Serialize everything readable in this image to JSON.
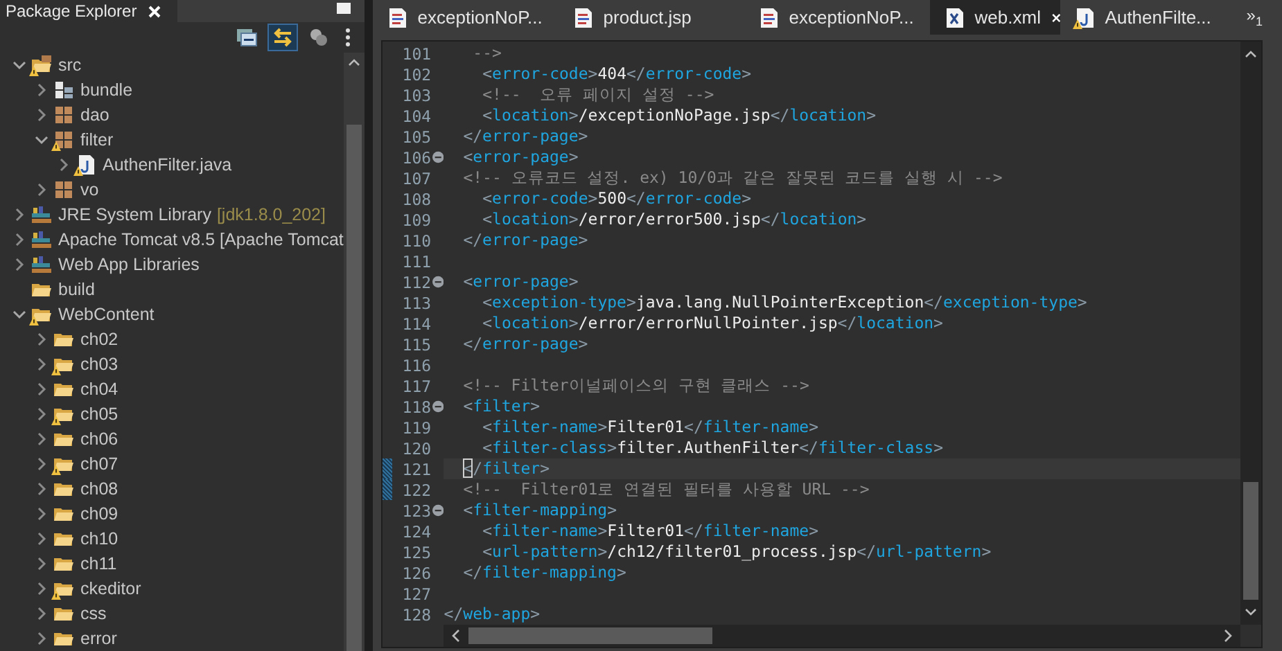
{
  "explorer": {
    "title": "Package Explorer",
    "toolbar": [
      {
        "kind": "collapse",
        "selected": false
      },
      {
        "kind": "link",
        "selected": true
      },
      {
        "kind": "filter",
        "selected": false
      },
      {
        "kind": "menu",
        "selected": false
      }
    ],
    "tree": [
      {
        "label": "src",
        "kind": "source-folder",
        "expanded": true,
        "warning": true,
        "children": [
          {
            "label": "bundle",
            "kind": "bundle",
            "expanded": false,
            "warning": false
          },
          {
            "label": "dao",
            "kind": "package",
            "expanded": false,
            "warning": false
          },
          {
            "label": "filter",
            "kind": "package",
            "expanded": true,
            "warning": true,
            "children": [
              {
                "label": "AuthenFilter.java",
                "kind": "java-file",
                "expanded": false,
                "warning": true
              }
            ]
          },
          {
            "label": "vo",
            "kind": "package",
            "expanded": false,
            "warning": false
          }
        ]
      },
      {
        "label": "JRE System Library",
        "decoration": "[jdk1.8.0_202]",
        "kind": "library",
        "expanded": false,
        "warning": false
      },
      {
        "label": "Apache Tomcat v8.5 [Apache Tomcat",
        "kind": "library",
        "expanded": false,
        "warning": false
      },
      {
        "label": "Web App Libraries",
        "kind": "library",
        "expanded": false,
        "warning": false
      },
      {
        "label": "build",
        "kind": "folder",
        "warning": false
      },
      {
        "label": "WebContent",
        "kind": "folder",
        "expanded": true,
        "warning": true,
        "children": [
          {
            "label": "ch02",
            "kind": "folder",
            "expanded": false,
            "warning": false
          },
          {
            "label": "ch03",
            "kind": "folder",
            "expanded": false,
            "warning": true
          },
          {
            "label": "ch04",
            "kind": "folder",
            "expanded": false,
            "warning": false
          },
          {
            "label": "ch05",
            "kind": "folder",
            "expanded": false,
            "warning": true
          },
          {
            "label": "ch06",
            "kind": "folder",
            "expanded": false,
            "warning": false
          },
          {
            "label": "ch07",
            "kind": "folder",
            "expanded": false,
            "warning": true
          },
          {
            "label": "ch08",
            "kind": "folder",
            "expanded": false,
            "warning": false
          },
          {
            "label": "ch09",
            "kind": "folder",
            "expanded": false,
            "warning": false
          },
          {
            "label": "ch10",
            "kind": "folder",
            "expanded": false,
            "warning": false
          },
          {
            "label": "ch11",
            "kind": "folder",
            "expanded": false,
            "warning": false
          },
          {
            "label": "ckeditor",
            "kind": "folder",
            "expanded": false,
            "warning": true
          },
          {
            "label": "css",
            "kind": "folder",
            "expanded": false,
            "warning": false
          },
          {
            "label": "error",
            "kind": "folder",
            "expanded": false,
            "warning": false
          }
        ]
      }
    ]
  },
  "tabs": [
    {
      "label": "exceptionNoP...",
      "kind": "jsp",
      "selected": false,
      "warning": false
    },
    {
      "label": "product.jsp",
      "kind": "jsp",
      "selected": false,
      "warning": false
    },
    {
      "label": "exceptionNoP...",
      "kind": "jsp",
      "selected": false,
      "warning": false
    },
    {
      "label": "web.xml",
      "kind": "xml",
      "selected": true,
      "warning": false
    },
    {
      "label": "AuthenFilte...",
      "kind": "java",
      "selected": false,
      "warning": true
    }
  ],
  "overflow": {
    "symbol": "»",
    "count": "1"
  },
  "lines": [
    {
      "n": "101",
      "kind": "continuation",
      "fold": false,
      "current": false,
      "changed": false,
      "tokens": [
        {
          "kind": "comment",
          "text": "-->"
        }
      ]
    },
    {
      "n": "102",
      "kind": "inner",
      "fold": false,
      "current": false,
      "changed": false,
      "tokens": [
        {
          "kind": "punct",
          "text": "<"
        },
        {
          "kind": "tag",
          "text": "error-code"
        },
        {
          "kind": "punct",
          "text": ">"
        },
        {
          "kind": "text",
          "text": "404"
        },
        {
          "kind": "punct",
          "text": "</"
        },
        {
          "kind": "tag",
          "text": "error-code"
        },
        {
          "kind": "punct",
          "text": ">"
        }
      ]
    },
    {
      "n": "103",
      "kind": "inner",
      "fold": false,
      "current": false,
      "changed": false,
      "tokens": [
        {
          "kind": "comment",
          "text": "<!--  오류 페이지 설정 -->"
        }
      ]
    },
    {
      "n": "104",
      "kind": "inner",
      "fold": false,
      "current": false,
      "changed": false,
      "tokens": [
        {
          "kind": "punct",
          "text": "<"
        },
        {
          "kind": "tag",
          "text": "location"
        },
        {
          "kind": "punct",
          "text": ">"
        },
        {
          "kind": "text",
          "text": "/exceptionNoPage.jsp"
        },
        {
          "kind": "punct",
          "text": "</"
        },
        {
          "kind": "tag",
          "text": "location"
        },
        {
          "kind": "punct",
          "text": ">"
        }
      ]
    },
    {
      "n": "105",
      "kind": "outer",
      "fold": false,
      "current": false,
      "changed": false,
      "tokens": [
        {
          "kind": "punct",
          "text": "</"
        },
        {
          "kind": "tag",
          "text": "error-page"
        },
        {
          "kind": "punct",
          "text": ">"
        }
      ]
    },
    {
      "n": "106",
      "kind": "outer",
      "fold": true,
      "current": false,
      "changed": false,
      "tokens": [
        {
          "kind": "punct",
          "text": "<"
        },
        {
          "kind": "tag",
          "text": "error-page"
        },
        {
          "kind": "punct",
          "text": ">"
        }
      ]
    },
    {
      "n": "107",
      "kind": "outer",
      "fold": false,
      "current": false,
      "changed": false,
      "tokens": [
        {
          "kind": "comment",
          "text": "<!-- 오류코드 설정. ex) 10/0과 같은 잘못된 코드를 실행 시 -->"
        }
      ]
    },
    {
      "n": "108",
      "kind": "inner",
      "fold": false,
      "current": false,
      "changed": false,
      "tokens": [
        {
          "kind": "punct",
          "text": "<"
        },
        {
          "kind": "tag",
          "text": "error-code"
        },
        {
          "kind": "punct",
          "text": ">"
        },
        {
          "kind": "text",
          "text": "500"
        },
        {
          "kind": "punct",
          "text": "</"
        },
        {
          "kind": "tag",
          "text": "error-code"
        },
        {
          "kind": "punct",
          "text": ">"
        }
      ]
    },
    {
      "n": "109",
      "kind": "inner",
      "fold": false,
      "current": false,
      "changed": false,
      "tokens": [
        {
          "kind": "punct",
          "text": "<"
        },
        {
          "kind": "tag",
          "text": "location"
        },
        {
          "kind": "punct",
          "text": ">"
        },
        {
          "kind": "text",
          "text": "/error/error500.jsp"
        },
        {
          "kind": "punct",
          "text": "</"
        },
        {
          "kind": "tag",
          "text": "location"
        },
        {
          "kind": "punct",
          "text": ">"
        }
      ]
    },
    {
      "n": "110",
      "kind": "outer",
      "fold": false,
      "current": false,
      "changed": false,
      "tokens": [
        {
          "kind": "punct",
          "text": "</"
        },
        {
          "kind": "tag",
          "text": "error-page"
        },
        {
          "kind": "punct",
          "text": ">"
        }
      ]
    },
    {
      "n": "111",
      "kind": "blank",
      "fold": false,
      "changed": false
    },
    {
      "n": "112",
      "kind": "outer",
      "fold": true,
      "current": false,
      "changed": false,
      "tokens": [
        {
          "kind": "punct",
          "text": "<"
        },
        {
          "kind": "tag",
          "text": "error-page"
        },
        {
          "kind": "punct",
          "text": ">"
        }
      ]
    },
    {
      "n": "113",
      "kind": "inner",
      "fold": false,
      "current": false,
      "changed": false,
      "tokens": [
        {
          "kind": "punct",
          "text": "<"
        },
        {
          "kind": "tag",
          "text": "exception-type"
        },
        {
          "kind": "punct",
          "text": ">"
        },
        {
          "kind": "text",
          "text": "java.lang.NullPointerException"
        },
        {
          "kind": "punct",
          "text": "</"
        },
        {
          "kind": "tag",
          "text": "exception-type"
        },
        {
          "kind": "punct",
          "text": ">"
        }
      ]
    },
    {
      "n": "114",
      "kind": "inner",
      "fold": false,
      "current": false,
      "changed": false,
      "tokens": [
        {
          "kind": "punct",
          "text": "<"
        },
        {
          "kind": "tag",
          "text": "location"
        },
        {
          "kind": "punct",
          "text": ">"
        },
        {
          "kind": "text",
          "text": "/error/errorNullPointer.jsp"
        },
        {
          "kind": "punct",
          "text": "</"
        },
        {
          "kind": "tag",
          "text": "location"
        },
        {
          "kind": "punct",
          "text": ">"
        }
      ]
    },
    {
      "n": "115",
      "kind": "outer",
      "fold": false,
      "current": false,
      "changed": false,
      "tokens": [
        {
          "kind": "punct",
          "text": "</"
        },
        {
          "kind": "tag",
          "text": "error-page"
        },
        {
          "kind": "punct",
          "text": ">"
        }
      ]
    },
    {
      "n": "116",
      "kind": "blank",
      "fold": false,
      "changed": false
    },
    {
      "n": "117",
      "kind": "outer",
      "fold": false,
      "current": false,
      "changed": false,
      "tokens": [
        {
          "kind": "comment",
          "text": "<!-- Filter이널페이스의 구현 클래스 -->"
        }
      ]
    },
    {
      "n": "118",
      "kind": "outer",
      "fold": true,
      "current": false,
      "changed": false,
      "tokens": [
        {
          "kind": "punct",
          "text": "<"
        },
        {
          "kind": "tag",
          "text": "filter"
        },
        {
          "kind": "punct",
          "text": ">"
        }
      ]
    },
    {
      "n": "119",
      "kind": "inner",
      "fold": false,
      "current": false,
      "changed": false,
      "tokens": [
        {
          "kind": "punct",
          "text": "<"
        },
        {
          "kind": "tag",
          "text": "filter-name"
        },
        {
          "kind": "punct",
          "text": ">"
        },
        {
          "kind": "text",
          "text": "Filter01"
        },
        {
          "kind": "punct",
          "text": "</"
        },
        {
          "kind": "tag",
          "text": "filter-name"
        },
        {
          "kind": "punct",
          "text": ">"
        }
      ]
    },
    {
      "n": "120",
      "kind": "inner",
      "fold": false,
      "current": false,
      "changed": false,
      "tokens": [
        {
          "kind": "punct",
          "text": "<"
        },
        {
          "kind": "tag",
          "text": "filter-class"
        },
        {
          "kind": "punct",
          "text": ">"
        },
        {
          "kind": "text",
          "text": "filter.AuthenFilter"
        },
        {
          "kind": "punct",
          "text": "</"
        },
        {
          "kind": "tag",
          "text": "filter-class"
        },
        {
          "kind": "punct",
          "text": ">"
        }
      ]
    },
    {
      "n": "121",
      "kind": "outer",
      "fold": false,
      "current": true,
      "changed": true,
      "tokens": [
        {
          "kind": "punct",
          "text": "</"
        },
        {
          "kind": "tag",
          "text": "filter"
        },
        {
          "kind": "punct",
          "text": ">"
        }
      ]
    },
    {
      "n": "122",
      "kind": "outer",
      "fold": false,
      "current": false,
      "changed": true,
      "tokens": [
        {
          "kind": "comment",
          "text": "<!--  Filter01로 연결된 필터를 사용할 URL -->"
        }
      ]
    },
    {
      "n": "123",
      "kind": "outer",
      "fold": true,
      "current": false,
      "changed": false,
      "tokens": [
        {
          "kind": "punct",
          "text": "<"
        },
        {
          "kind": "tag",
          "text": "filter-mapping"
        },
        {
          "kind": "punct",
          "text": ">"
        }
      ]
    },
    {
      "n": "124",
      "kind": "inner",
      "fold": false,
      "current": false,
      "changed": false,
      "tokens": [
        {
          "kind": "punct",
          "text": "<"
        },
        {
          "kind": "tag",
          "text": "filter-name"
        },
        {
          "kind": "punct",
          "text": ">"
        },
        {
          "kind": "text",
          "text": "Filter01"
        },
        {
          "kind": "punct",
          "text": "</"
        },
        {
          "kind": "tag",
          "text": "filter-name"
        },
        {
          "kind": "punct",
          "text": ">"
        }
      ]
    },
    {
      "n": "125",
      "kind": "inner",
      "fold": false,
      "current": false,
      "changed": false,
      "tokens": [
        {
          "kind": "punct",
          "text": "<"
        },
        {
          "kind": "tag",
          "text": "url-pattern"
        },
        {
          "kind": "punct",
          "text": ">"
        },
        {
          "kind": "text",
          "text": "/ch12/filter01_process.jsp"
        },
        {
          "kind": "punct",
          "text": "</"
        },
        {
          "kind": "tag",
          "text": "url-pattern"
        },
        {
          "kind": "punct",
          "text": ">"
        }
      ]
    },
    {
      "n": "126",
      "kind": "outer",
      "fold": false,
      "current": false,
      "changed": false,
      "tokens": [
        {
          "kind": "punct",
          "text": "</"
        },
        {
          "kind": "tag",
          "text": "filter-mapping"
        },
        {
          "kind": "punct",
          "text": ">"
        }
      ]
    },
    {
      "n": "127",
      "kind": "blank",
      "fold": false,
      "changed": false
    },
    {
      "n": "128",
      "kind": "top",
      "fold": false,
      "current": false,
      "changed": false,
      "tokens": [
        {
          "kind": "punct",
          "text": "</"
        },
        {
          "kind": "tag",
          "text": "web-app"
        },
        {
          "kind": "punct",
          "text": ">"
        }
      ]
    }
  ]
}
